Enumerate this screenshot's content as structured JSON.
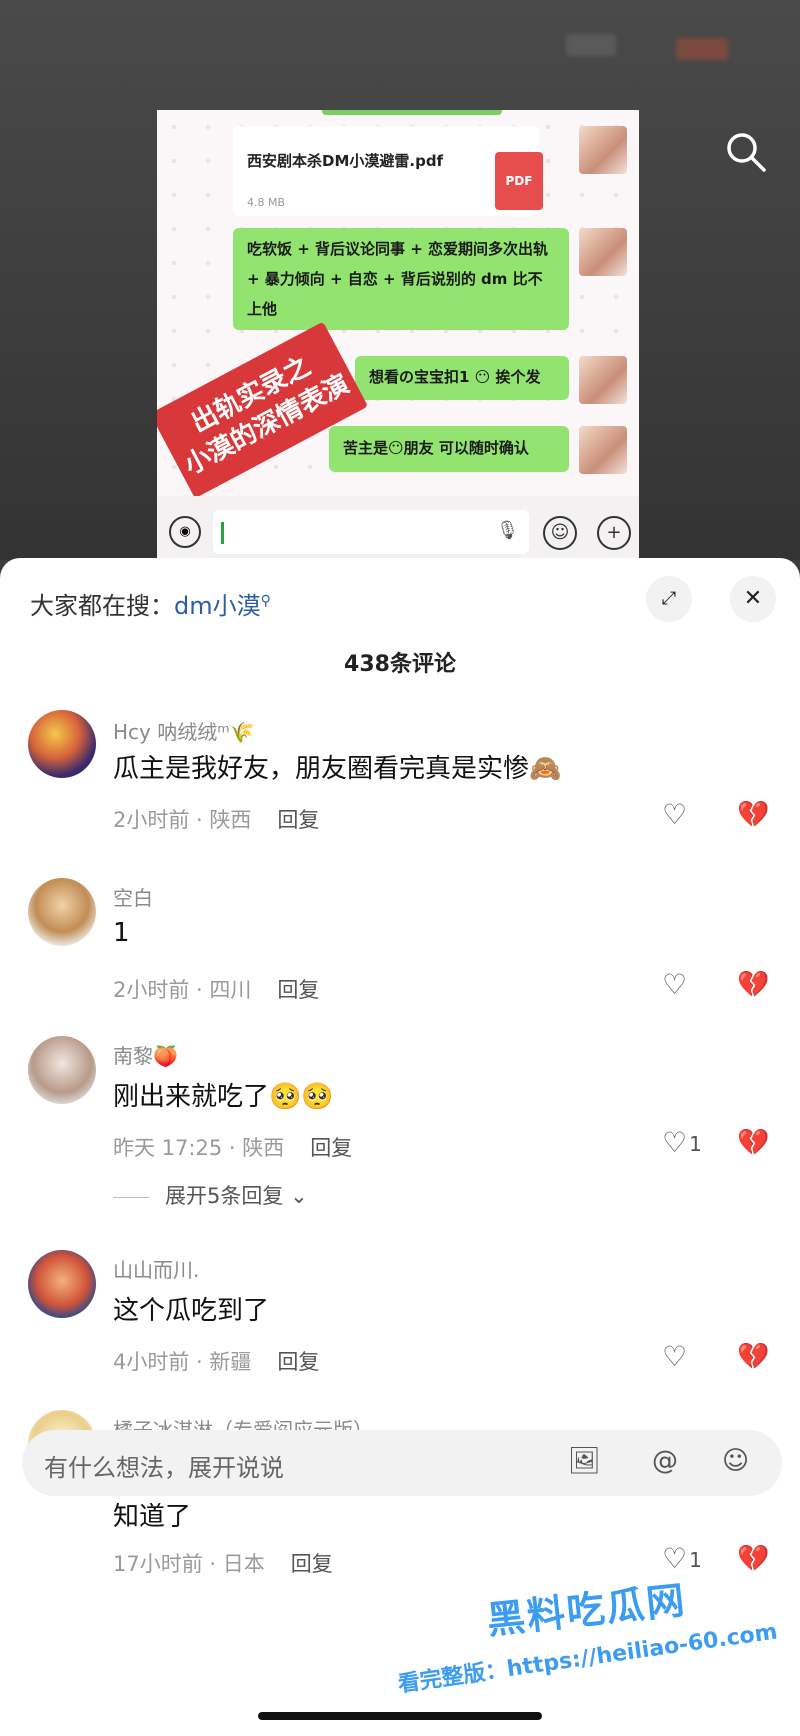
{
  "chat": {
    "pdf_name": "西安剧本杀DM小漠避雷.pdf",
    "pdf_size": "4.8 MB",
    "pdf_badge": "PDF",
    "bubble_1": "吃软饭 + 背后议论同事 + 恋爱期间多次出轨+ 暴力倾向 + 自恋 + 背后说别的 dm 比不上他",
    "bubble_2": "想看の宝宝扣1 😶 挨个发",
    "bubble_3": "苦主是😶朋友 可以随时确认",
    "stamp_line1": "出轨实录之",
    "stamp_line2": "小漠的深情表演"
  },
  "sheet": {
    "hot_search_label": "大家都在搜：",
    "hot_search_keyword": "dm小漠",
    "comment_count": "438条评论",
    "reply_label": "回复"
  },
  "comments": [
    {
      "user": "Hcy 呐绒绒ᵐ🌾",
      "text": "瓜主是我好友，朋友圈看完真是实惨🙈",
      "time": "2小时前 · 陕西",
      "likes": ""
    },
    {
      "user": "空白",
      "text": "1",
      "time": "2小时前 · 四川",
      "likes": ""
    },
    {
      "user": "南黎🍑",
      "text": "刚出来就吃了🥺🥺",
      "time": "昨天 17:25 · 陕西",
      "likes": "1",
      "expand": "展开5条回复"
    },
    {
      "user": "山山而川.",
      "text": "这个瓜吃到了",
      "time": "4小时前 · 新疆",
      "likes": ""
    },
    {
      "user": "橘子冰淇淋（专爱阎应元版）",
      "text": "昨天吃完发给我朋友们，震惊了，目前日本剧本杀基本都知道了",
      "time": "17小时前 · 日本",
      "likes": "1"
    }
  ],
  "input": {
    "placeholder": "有什么想法，展开说说"
  },
  "watermark": {
    "brand": "黑料吃瓜网",
    "url": "看完整版：https://heiliao-60.com"
  },
  "colors": {
    "bubble_green": "#92e36f",
    "keyword_blue": "#2c5ca8",
    "stamp_red": "#d9383a",
    "watermark_blue": "#3c9cf2"
  }
}
